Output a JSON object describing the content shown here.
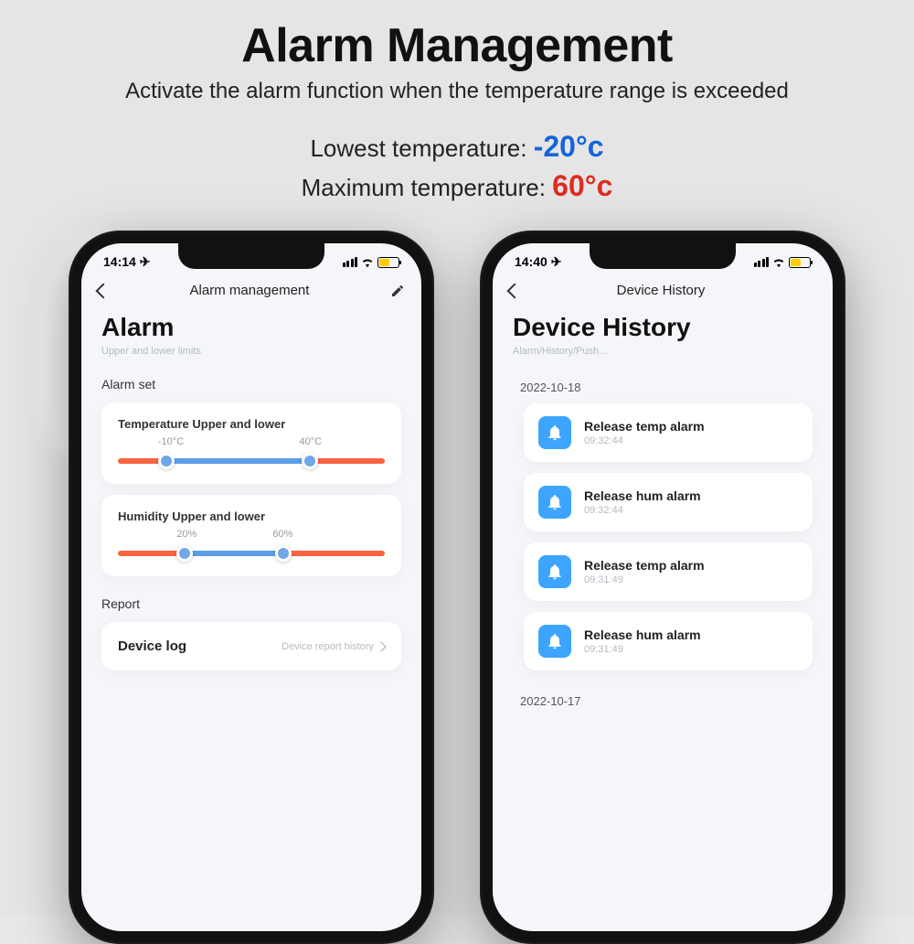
{
  "hero": {
    "title": "Alarm Management",
    "subtitle": "Activate the alarm function when the temperature range is exceeded",
    "low_label": "Lowest temperature: ",
    "low_value": "-20°c",
    "max_label": "Maximum temperature: ",
    "max_value": "60°c"
  },
  "phone1": {
    "time": "14:14",
    "nav_title": "Alarm management",
    "heading": "Alarm",
    "subheading": "Upper and lower limits",
    "section_alarm_set": "Alarm set",
    "card_temp_title": "Temperature Upper and lower",
    "temp_low": "-10°C",
    "temp_high": "40°C",
    "card_hum_title": "Humidity Upper and lower",
    "hum_low": "20%",
    "hum_high": "60%",
    "section_report": "Report",
    "device_log": "Device log",
    "device_log_hint": "Device report history"
  },
  "phone2": {
    "time": "14:40",
    "nav_title": "Device History",
    "heading": "Device History",
    "subheading": "Alarm/History/Push...",
    "date1": "2022-10-18",
    "items1": [
      {
        "title": "Release temp alarm",
        "time": "09:32:44"
      },
      {
        "title": "Release hum alarm",
        "time": "09:32:44"
      },
      {
        "title": "Release temp alarm",
        "time": "09:31:49"
      },
      {
        "title": "Release hum alarm",
        "time": "09:31:49"
      }
    ],
    "date2": "2022-10-17"
  }
}
